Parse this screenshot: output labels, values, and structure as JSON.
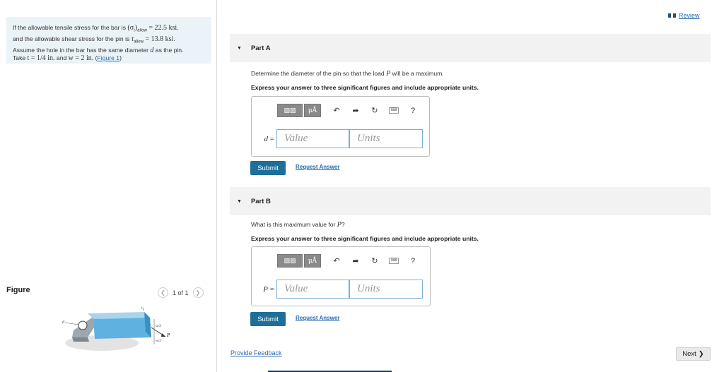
{
  "problem": {
    "t1": "If the allowable tensile stress for the bar is ",
    "sigma": "(σ",
    "sub_t": "t",
    "close": ")",
    "sub_allow1": "allow",
    "eq1": " = 22.5 ksi",
    "t2": ",",
    "t3": "and the allowable shear stress for the pin is ",
    "tau": "τ",
    "sub_allow2": "allow",
    "eq2": " = 13.8 ksi",
    "t4": ".",
    "t5": "Assume the hole in the bar has the same diameter ",
    "d": "d",
    "t6": " as the pin.",
    "t7": "Take ",
    "teq": "t = 1/4 in.",
    "t8": " and ",
    "weq": "w = 2 in.",
    "t9": " (",
    "fig_link": "Figure 1",
    "t10": ")"
  },
  "figure": {
    "title": "Figure",
    "counter": "1 of 1",
    "labels": {
      "d": "d",
      "t": "t",
      "w2a": "w/2",
      "w2b": "w/2",
      "P": "P"
    }
  },
  "header": {
    "review_label": "Review"
  },
  "partA": {
    "label": "Part A",
    "question_pre": "Determine the diameter of the pin so that the load ",
    "question_var": "P",
    "question_post": " will be a maximum.",
    "instructions": "Express your answer to three significant figures and include appropriate units.",
    "var_label": "d",
    "eq": " =",
    "value_placeholder": "Value",
    "units_placeholder": "Units",
    "submit": "Submit",
    "request": "Request Answer"
  },
  "partB": {
    "label": "Part B",
    "question_pre": "What is this maximum value for ",
    "question_var": "P",
    "question_post": "?",
    "instructions": "Express your answer to three significant figures and include appropriate units.",
    "var_label": "P",
    "eq": " =",
    "value_placeholder": "Value",
    "units_placeholder": "Units",
    "submit": "Submit",
    "request": "Request Answer"
  },
  "toolbar": {
    "mu": "μÅ",
    "help": "?"
  },
  "footer": {
    "feedback": "Provide Feedback",
    "next": "Next"
  }
}
